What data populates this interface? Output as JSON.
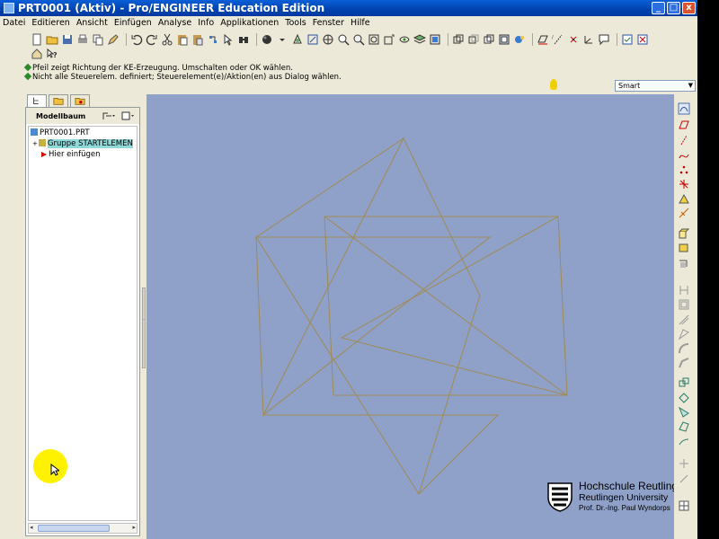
{
  "window": {
    "title": "PRT0001 (Aktiv) - Pro/ENGINEER Education Edition",
    "min_label": "_",
    "max_label": "□",
    "close_label": "x"
  },
  "menu": [
    "Datei",
    "Editieren",
    "Ansicht",
    "Einfügen",
    "Analyse",
    "Info",
    "Applikationen",
    "Tools",
    "Fenster",
    "Hilfe"
  ],
  "messages": [
    "Pfeil zeigt Richtung der KE-Erzeugung. Umschalten oder OK wählen.",
    "Nicht alle Steuerelem. definiert; Steuerelement(e)/Aktion(en) aus Dialog wählen."
  ],
  "filter": {
    "value": "Smart"
  },
  "model_tree": {
    "header": "Modellbaum",
    "items": [
      {
        "label": "PRT0001.PRT"
      },
      {
        "label": "Gruppe STARTELEMEN"
      },
      {
        "label": "Hier einfügen"
      }
    ]
  },
  "logo": {
    "line1": "Hochschule Reutlingen",
    "line2": "Reutlingen University",
    "line3": "Prof. Dr.-Ing. Paul Wyndorps"
  },
  "colors": {
    "viewport_bg": "#8fa1c8",
    "sketch_line": "#a08a55",
    "title_bar": "#0042b0",
    "selection": "#8fd8d8"
  },
  "icons": {
    "toolbar_row1": [
      "new-icon",
      "open-icon",
      "save-icon",
      "print-icon",
      "copy-icon",
      "undo-icon",
      "redo-icon",
      "cut-icon",
      "paste-icon",
      "regenerate-icon",
      "find-icon",
      "shading-icon",
      "spin-icon",
      "zoom-in-icon",
      "zoom-out-icon",
      "refit-icon",
      "reorient-icon",
      "view-icon",
      "layers-icon",
      "datum-icon",
      "plane-icon",
      "axis-icon",
      "point-icon",
      "csys-icon",
      "hidden-icon",
      "close-window-icon"
    ],
    "right_toolbar": [
      "sketch-icon",
      "plane-icon",
      "axis-icon",
      "curve-icon",
      "point-icon",
      "csys-icon",
      "analysis-icon",
      "datum-icon",
      "extrude-icon",
      "revolve-icon",
      "sweep-icon",
      "hole-icon",
      "round-icon",
      "chamfer-icon",
      "rib-icon",
      "shell-icon",
      "draft-icon",
      "pattern-icon",
      "mirror-icon",
      "merge-icon",
      "trim-icon",
      "offset-icon"
    ]
  }
}
